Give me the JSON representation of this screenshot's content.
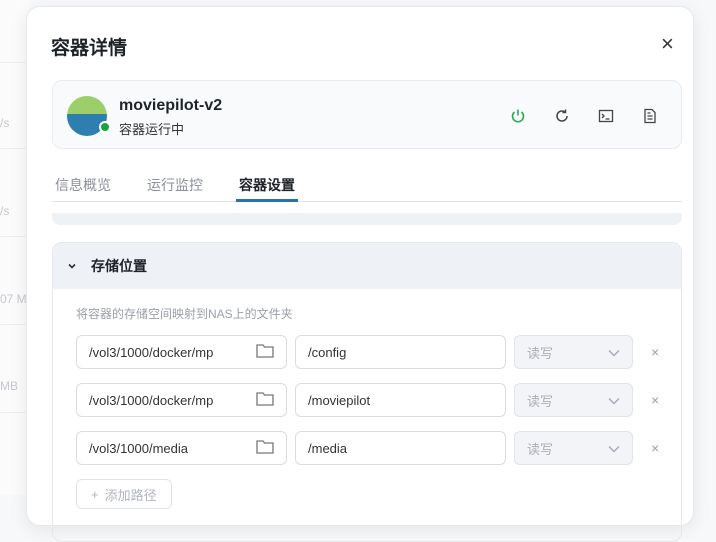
{
  "background": {
    "fragments": [
      "/s",
      "/s",
      "07 M",
      "MB"
    ]
  },
  "dialog": {
    "title": "容器详情",
    "close": "×"
  },
  "container": {
    "name": "moviepilot-v2",
    "status": "容器运行中",
    "status_color": "#1aa33a"
  },
  "tabs": [
    {
      "label": "信息概览"
    },
    {
      "label": "运行监控"
    },
    {
      "label": "容器设置"
    }
  ],
  "storage": {
    "title": "存储位置",
    "description": "将容器的存储空间映射到NAS上的文件夹",
    "rows": [
      {
        "host": "/vol3/1000/docker/mp",
        "container": "/config",
        "mode": "读写"
      },
      {
        "host": "/vol3/1000/docker/mp",
        "container": "/moviepilot",
        "mode": "读写"
      },
      {
        "host": "/vol3/1000/media",
        "container": "/media",
        "mode": "读写"
      }
    ],
    "add_label": "添加路径"
  }
}
